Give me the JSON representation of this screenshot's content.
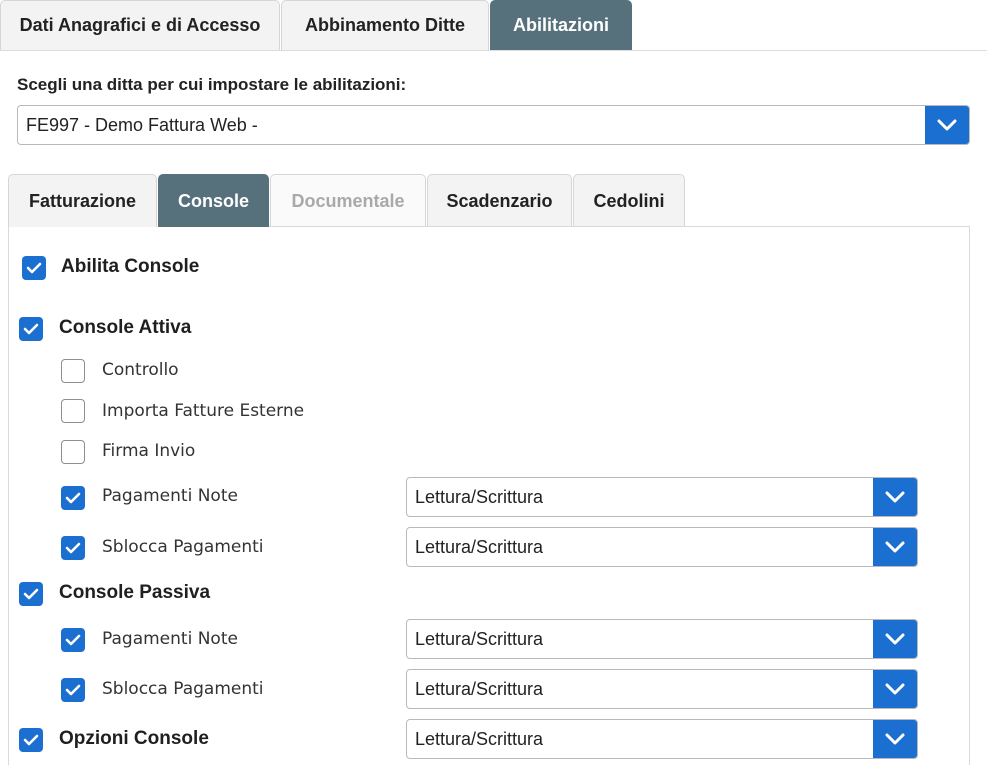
{
  "top_tabs": [
    {
      "label": "Dati Anagrafici e di Accesso"
    },
    {
      "label": "Abbinamento Ditte"
    },
    {
      "label": "Abilitazioni"
    }
  ],
  "company_select": {
    "label": "Scegli una ditta per cui impostare le abilitazioni:",
    "value": "FE997 - Demo Fattura Web -"
  },
  "inner_tabs": [
    {
      "label": "Fatturazione"
    },
    {
      "label": "Console"
    },
    {
      "label": "Documentale"
    },
    {
      "label": "Scadenzario"
    },
    {
      "label": "Cedolini"
    }
  ],
  "console": {
    "abilita": {
      "label": "Abilita Console",
      "checked": true
    },
    "attiva": {
      "label": "Console Attiva",
      "checked": true,
      "items": [
        {
          "label": "Controllo",
          "checked": false
        },
        {
          "label": "Importa Fatture Esterne",
          "checked": false
        },
        {
          "label": "Firma Invio",
          "checked": false
        },
        {
          "label": "Pagamenti Note",
          "checked": true,
          "access": "Lettura/Scrittura"
        },
        {
          "label": "Sblocca Pagamenti",
          "checked": true,
          "access": "Lettura/Scrittura"
        }
      ]
    },
    "passiva": {
      "label": "Console Passiva",
      "checked": true,
      "items": [
        {
          "label": "Pagamenti Note",
          "checked": true,
          "access": "Lettura/Scrittura"
        },
        {
          "label": "Sblocca Pagamenti",
          "checked": true,
          "access": "Lettura/Scrittura"
        }
      ]
    },
    "opzioni": {
      "label": "Opzioni Console",
      "checked": true,
      "access": "Lettura/Scrittura"
    }
  },
  "colors": {
    "accent": "#1b6fd1",
    "active_tab": "#56707c"
  }
}
